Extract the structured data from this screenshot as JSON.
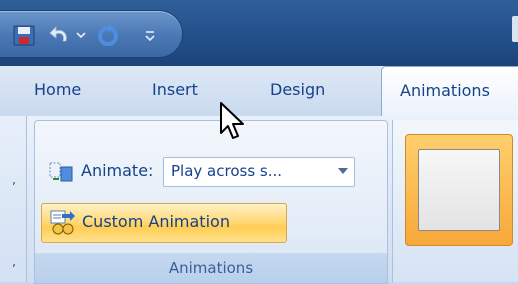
{
  "tabs": {
    "home": "Home",
    "insert": "Insert",
    "design": "Design",
    "animations": "Animations"
  },
  "animations_group": {
    "animate_label": "Animate:",
    "animate_value": "Play across s...",
    "custom_animation_label": "Custom Animation",
    "group_label": "Animations"
  },
  "icons": {
    "save": "save-icon",
    "undo": "undo-icon",
    "dropdown": "chevron-down-icon",
    "redo": "redo-icon",
    "customize": "customize-qat-icon",
    "animate": "animate-icon",
    "custom_animation": "custom-animation-icon",
    "cursor": "mouse-pointer-icon"
  },
  "colors": {
    "title_bar": "#24508a",
    "tab_text": "#15428b",
    "hover_button": "#ffd97a"
  }
}
